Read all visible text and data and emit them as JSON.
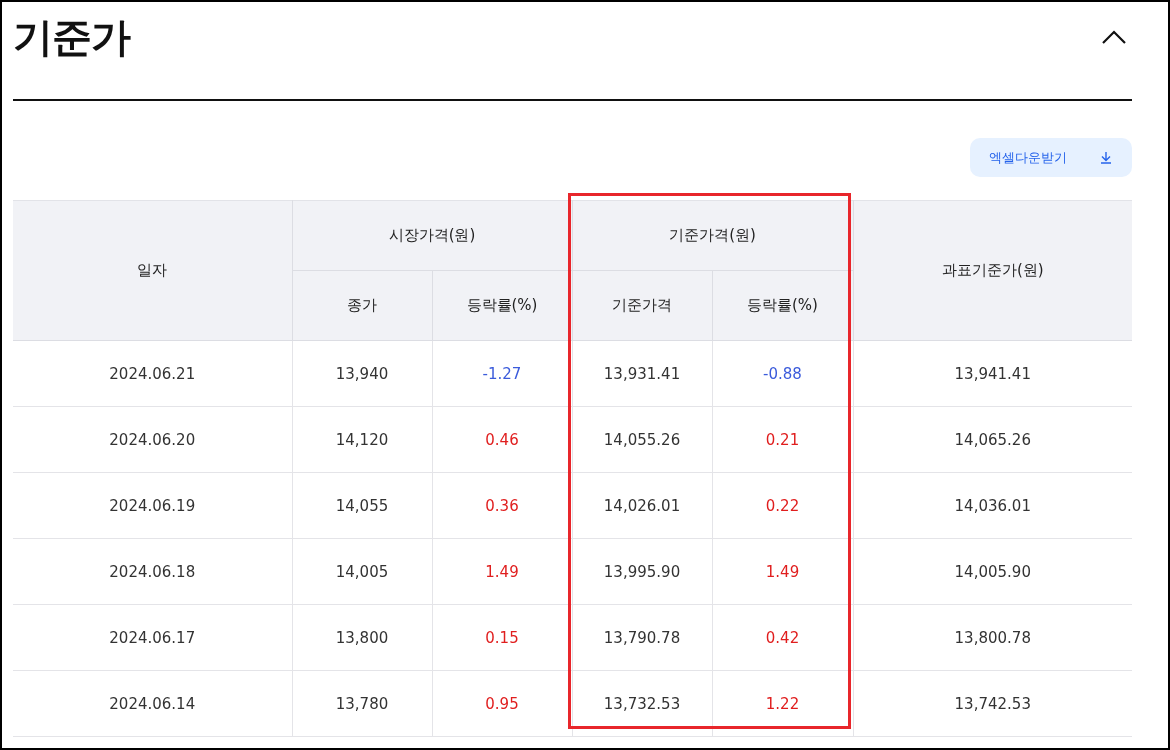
{
  "title": "기준가",
  "collapsed": false,
  "download_button": {
    "label": "엑셀다운받기"
  },
  "table": {
    "date_header": "일자",
    "groups": [
      {
        "label": "시장가격(원)",
        "highlighted": false,
        "subcolumns": [
          "종가",
          "등락률(%)"
        ]
      },
      {
        "label": "기준가격(원)",
        "highlighted": true,
        "subcolumns": [
          "기준가격",
          "등락률(%)"
        ]
      }
    ],
    "tax_header": "과표기준가(원)",
    "rows": [
      {
        "date": "2024.06.21",
        "close": "13,940",
        "close_change": {
          "value": "-1.27",
          "down": true
        },
        "nav": "13,931.41",
        "nav_change": {
          "value": "-0.88",
          "down": true
        },
        "tax_base": "13,941.41"
      },
      {
        "date": "2024.06.20",
        "close": "14,120",
        "close_change": {
          "value": "0.46",
          "down": false
        },
        "nav": "14,055.26",
        "nav_change": {
          "value": "0.21",
          "down": false
        },
        "tax_base": "14,065.26"
      },
      {
        "date": "2024.06.19",
        "close": "14,055",
        "close_change": {
          "value": "0.36",
          "down": false
        },
        "nav": "14,026.01",
        "nav_change": {
          "value": "0.22",
          "down": false
        },
        "tax_base": "14,036.01"
      },
      {
        "date": "2024.06.18",
        "close": "14,005",
        "close_change": {
          "value": "1.49",
          "down": false
        },
        "nav": "13,995.90",
        "nav_change": {
          "value": "1.49",
          "down": false
        },
        "tax_base": "14,005.90"
      },
      {
        "date": "2024.06.17",
        "close": "13,800",
        "close_change": {
          "value": "0.15",
          "down": false
        },
        "nav": "13,790.78",
        "nav_change": {
          "value": "0.42",
          "down": false
        },
        "tax_base": "13,800.78"
      },
      {
        "date": "2024.06.14",
        "close": "13,780",
        "close_change": {
          "value": "0.95",
          "down": false
        },
        "nav": "13,732.53",
        "nav_change": {
          "value": "1.22",
          "down": false
        },
        "tax_base": "13,742.53"
      }
    ]
  }
}
